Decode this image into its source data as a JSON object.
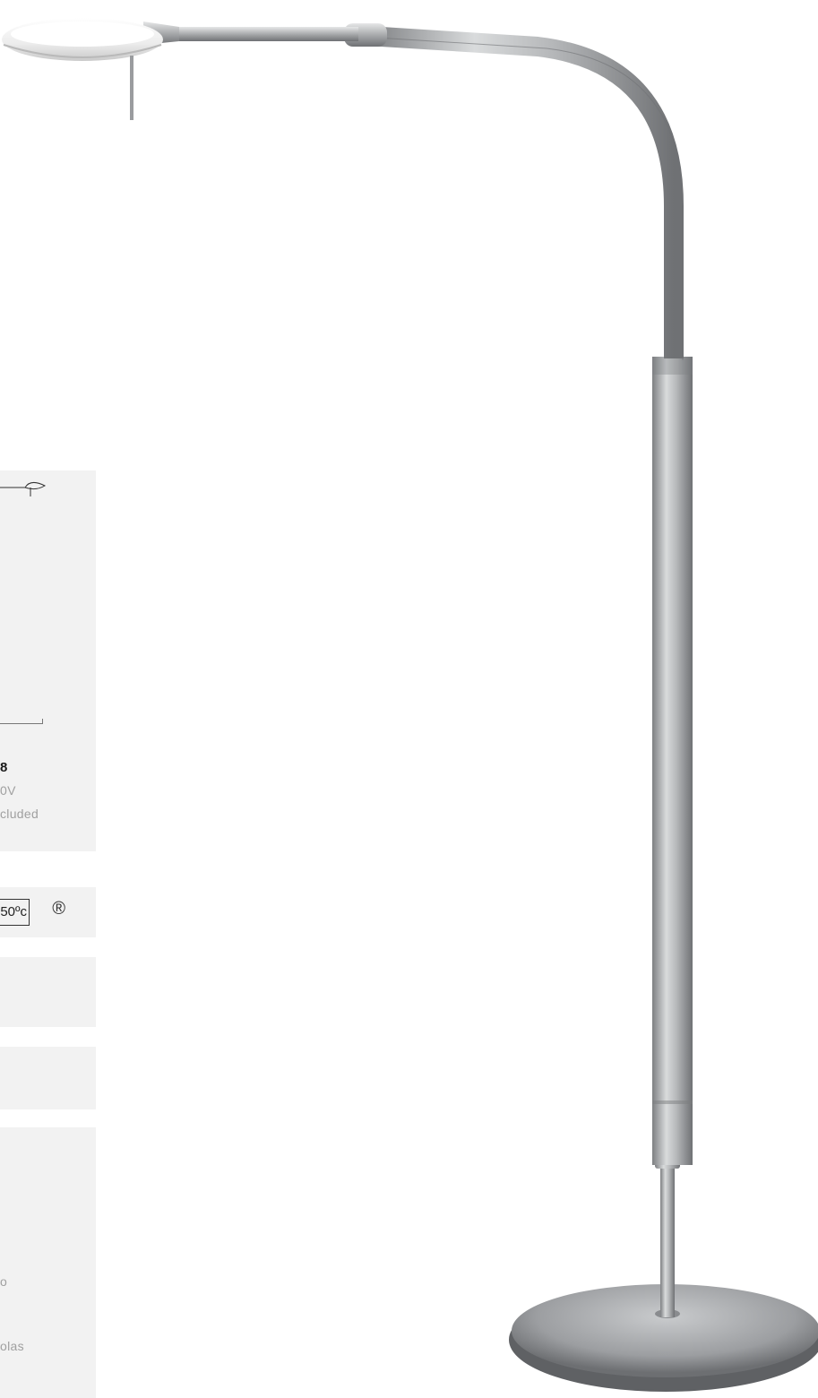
{
  "spec_panel": {
    "model_suffix": "8",
    "voltage": "0V",
    "bulb_note": "cluded",
    "temp_rating": "50ºc",
    "registered_mark": "®",
    "footer_fragment_1": "o",
    "footer_fragment_2": "olas"
  },
  "colors": {
    "panel": "#f2f2f2",
    "muted_text": "#a0a0a0",
    "metal": "#b4b6b8",
    "shade": "#f2f2f2"
  }
}
